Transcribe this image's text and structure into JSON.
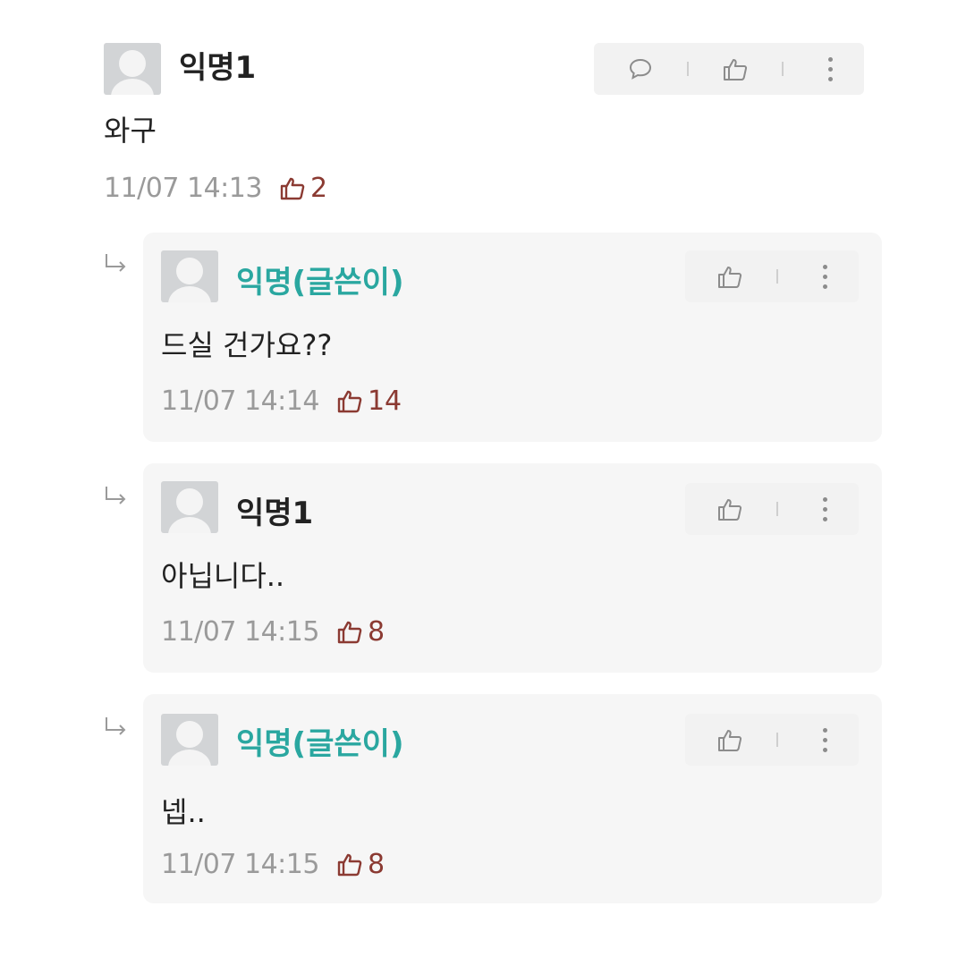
{
  "comments": [
    {
      "author": "익명1",
      "is_op": false,
      "text": "와구",
      "time": "11/07 14:13",
      "likes": "2"
    },
    {
      "author": "익명(글쓴이)",
      "is_op": true,
      "text": "드실 건가요??",
      "time": "11/07 14:14",
      "likes": "14"
    },
    {
      "author": "익명1",
      "is_op": false,
      "text": "아닙니다..",
      "time": "11/07 14:15",
      "likes": "8"
    },
    {
      "author": "익명(글쓴이)",
      "is_op": true,
      "text": "넵..",
      "time": "11/07 14:15",
      "likes": "8"
    }
  ],
  "colors": {
    "op_name": "#2aa7a0",
    "like_count": "#8b3a32",
    "timestamp": "#9a9a9a",
    "reply_bg": "#f6f6f6"
  },
  "icons": [
    "comment-icon",
    "thumbs-up-icon",
    "more-icon",
    "reply-arrow-icon",
    "avatar-icon"
  ]
}
